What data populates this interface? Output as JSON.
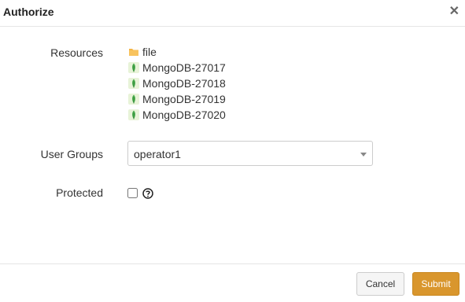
{
  "dialog": {
    "title": "Authorize",
    "close_icon": "close-icon"
  },
  "form": {
    "resources_label": "Resources",
    "resources": [
      {
        "name": "file",
        "icon": "folder-icon"
      },
      {
        "name": "MongoDB-27017",
        "icon": "mongodb-icon"
      },
      {
        "name": "MongoDB-27018",
        "icon": "mongodb-icon"
      },
      {
        "name": "MongoDB-27019",
        "icon": "mongodb-icon"
      },
      {
        "name": "MongoDB-27020",
        "icon": "mongodb-icon"
      }
    ],
    "user_groups_label": "User Groups",
    "user_groups_value": "operator1",
    "protected_label": "Protected",
    "protected_checked": false
  },
  "footer": {
    "cancel_label": "Cancel",
    "submit_label": "Submit"
  },
  "colors": {
    "submit": "#d9962d",
    "folder": "#f5b544",
    "mongodb_leaf": "#4caf50"
  }
}
